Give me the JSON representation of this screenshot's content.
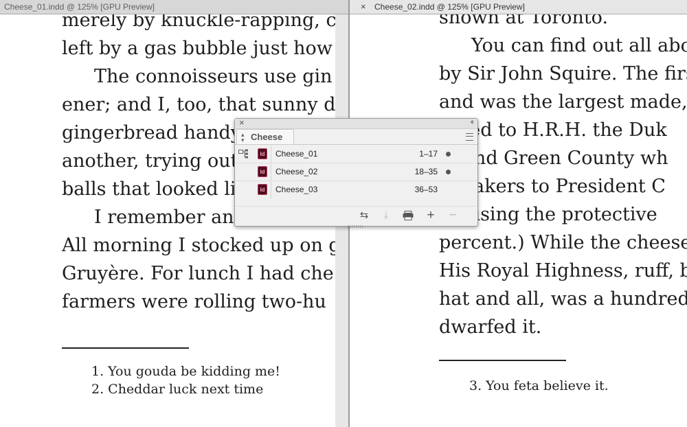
{
  "tabs": {
    "left": {
      "title": "Cheese_01.indd @ 125% [GPU Preview]"
    },
    "right": {
      "title": "Cheese_02.indd @ 125% [GPU Preview]",
      "close_glyph": "×"
    }
  },
  "left_page": {
    "lines": [
      "merely by knuckle-rapping, ca",
      "left by a gas bubble just how m",
      "The connoisseurs use gin",
      "ener; and I, too, that sunny da",
      "gingerbread handy",
      "another, trying out",
      "balls that looked lik",
      "I remember an",
      "All morning I stocked up on g",
      "Gruyère. For lunch I had che",
      "farmers were rolling two-hu"
    ],
    "footnotes": [
      "1. You gouda be kidding me!",
      "2. Cheddar luck next time"
    ]
  },
  "right_page": {
    "lines": [
      "shown at Toronto.",
      "You can find out all abou",
      "by Sir John Squire. The firs",
      "and was the largest made, u",
      "ented to H.R.H. the Duk",
      "pound Green County wh",
      "e makers to President C",
      "s raising the protective",
      "percent.) While the cheese",
      "His Royal Highness, ruff, b",
      "hat and all, was a hundred-",
      "dwarfed it."
    ],
    "footnotes": [
      "3. You feta believe it."
    ]
  },
  "book_panel": {
    "close_glyph": "×",
    "collapse_glyph": "‹‹",
    "tab_label": "Cheese",
    "documents": [
      {
        "name": "Cheese_01",
        "pages": "1–17",
        "open": true
      },
      {
        "name": "Cheese_02",
        "pages": "18–35",
        "open": true
      },
      {
        "name": "Cheese_03",
        "pages": "36–53",
        "open": false
      }
    ],
    "badge_text": "Id",
    "footer_buttons": [
      {
        "icon": "synchronize-icon",
        "glyph": "⇆"
      },
      {
        "icon": "save-book-icon",
        "glyph": "⤓"
      },
      {
        "icon": "print-book-icon",
        "glyph": "▭"
      },
      {
        "icon": "add-document-icon",
        "glyph": "+"
      },
      {
        "icon": "remove-document-icon",
        "glyph": "−"
      }
    ],
    "colors": {
      "indesign_badge": "#4a0d1f",
      "indesign_badge_border": "#c23a5a"
    }
  }
}
